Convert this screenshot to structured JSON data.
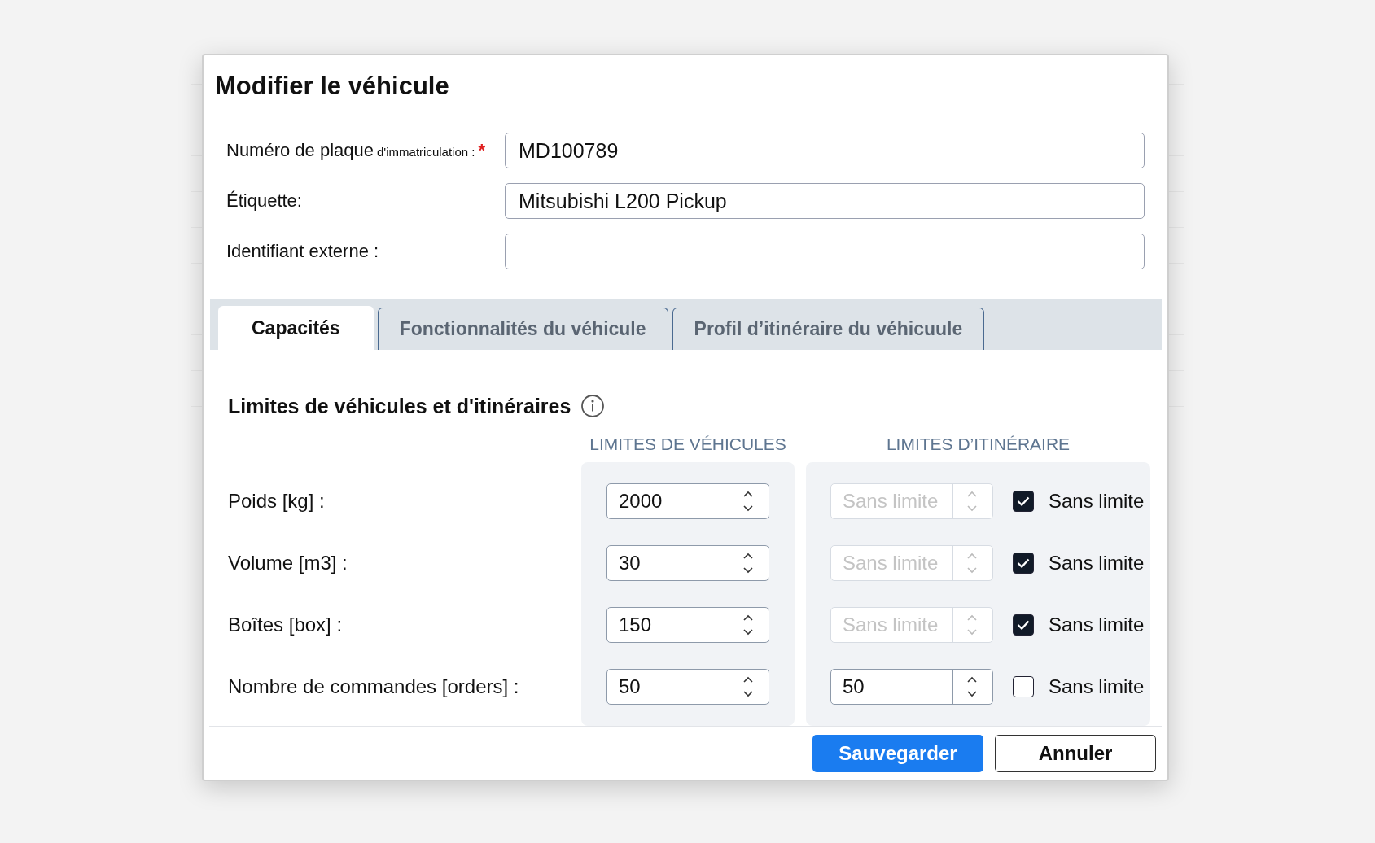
{
  "dialog": {
    "title": "Modifier le véhicule",
    "fields": [
      {
        "label": "Numéro de plaque",
        "label_suffix": "d'immatriculation :",
        "required_mark": "*",
        "value": "MD100789"
      },
      {
        "label": "Étiquette:",
        "value": "Mitsubishi L200 Pickup"
      },
      {
        "label": "Identifiant externe :"
      }
    ],
    "tabs": [
      {
        "label": "Capacités",
        "selected": true
      },
      {
        "label": "Fonctionnalités du véhicule",
        "selected": false
      },
      {
        "label": "Profil d’itinéraire du véhicuule",
        "selected": false
      }
    ],
    "limits": {
      "title": "Limites de véhicules et d'itinéraires",
      "columns": [
        "LIMITES DE VÉHICULES",
        "LIMITES D’ITINÉRAIRE"
      ],
      "rows": [
        {
          "label": "Poids [kg] :",
          "vehicle_value": "2000",
          "route_placeholder": "Sans limite",
          "unlimited": true,
          "unlimited_label": "Sans limite"
        },
        {
          "label": "Volume [m3] :",
          "vehicle_value": "30",
          "route_placeholder": "Sans limite",
          "unlimited": true,
          "unlimited_label": "Sans limite"
        },
        {
          "label": "Boîtes [box] :",
          "vehicle_value": "150",
          "route_placeholder": "Sans limite",
          "unlimited": true,
          "unlimited_label": "Sans limite"
        },
        {
          "label": "Nombre de commandes [orders] :",
          "vehicle_value": "50",
          "route_value": "50",
          "unlimited": false,
          "unlimited_label": "Sans limite"
        }
      ]
    },
    "buttons": [
      {
        "label": "Sauvegarder",
        "kind": "primary"
      },
      {
        "label": "Annuler",
        "kind": "secondary"
      }
    ]
  }
}
